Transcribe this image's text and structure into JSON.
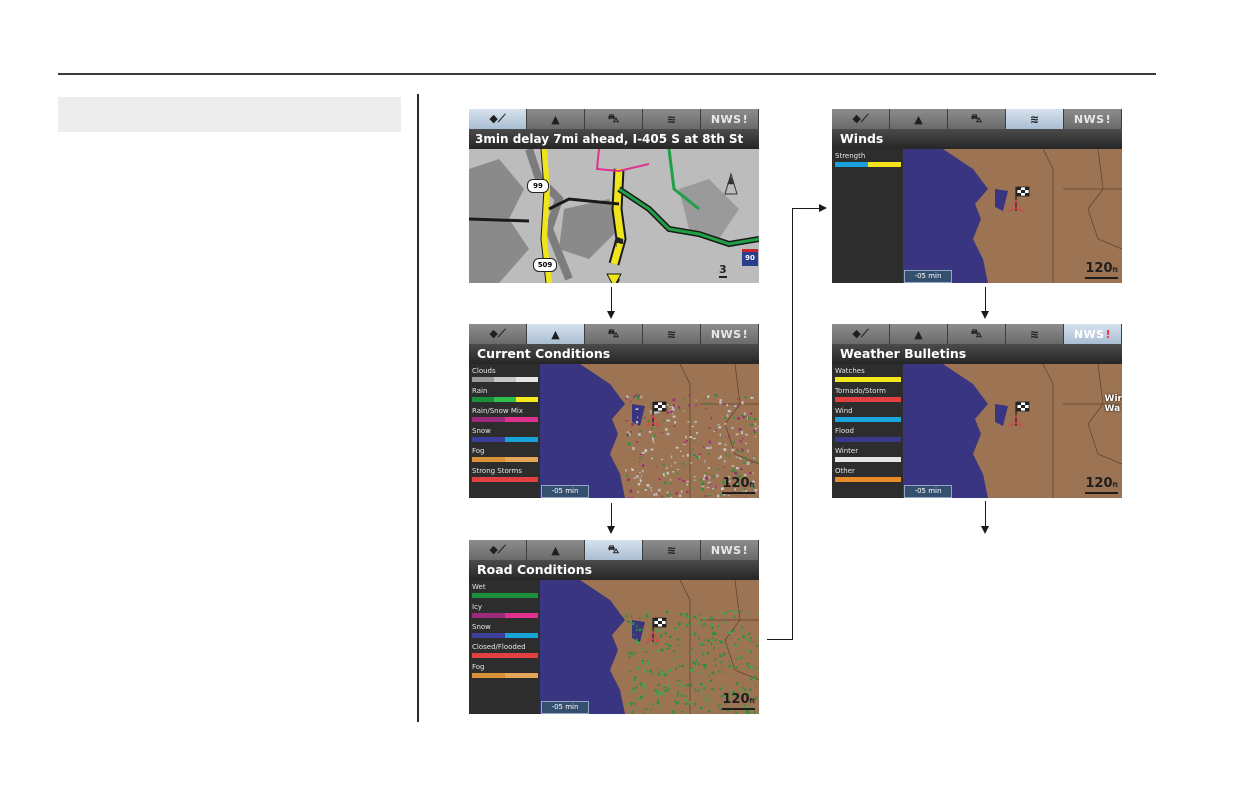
{
  "tabs": {
    "nws": "NWS",
    "nws_bang": "!"
  },
  "traffic": {
    "title": "3min delay 7mi ahead, I-405 S at 8th St",
    "shield_99": "99",
    "shield_509": "509",
    "shield_90": "90",
    "scale": "3"
  },
  "winds": {
    "title": "Winds",
    "legend": [
      {
        "label": "Strength",
        "colors": [
          "#1aa0dc",
          "#f4e31a"
        ]
      }
    ],
    "time": "-05 min",
    "scale": "120",
    "scale_unit": "ft"
  },
  "current": {
    "title": "Current Conditions",
    "legend": [
      {
        "label": "Clouds",
        "colors": [
          "#9a9a9a",
          "#c8c8c8",
          "#e5e5e5"
        ]
      },
      {
        "label": "Rain",
        "colors": [
          "#1c8f3c",
          "#2ec04a",
          "#f4ea1f"
        ]
      },
      {
        "label": "Rain/Snow Mix",
        "colors": [
          "#9b2a7a",
          "#e0318e"
        ]
      },
      {
        "label": "Snow",
        "colors": [
          "#3b3f9a",
          "#17a3d8"
        ]
      },
      {
        "label": "Fog",
        "colors": [
          "#d9913a",
          "#e3a659"
        ]
      },
      {
        "label": "Strong Storms",
        "colors": [
          "#e0403f"
        ]
      }
    ],
    "time": "-05 min",
    "scale": "120",
    "scale_unit": "ft"
  },
  "bulletins": {
    "title": "Weather Bulletins",
    "legend": [
      {
        "label": "Watches",
        "colors": [
          "#f4e71c"
        ]
      },
      {
        "label": "Tornado/Storm",
        "colors": [
          "#e0403f"
        ]
      },
      {
        "label": "Wind",
        "colors": [
          "#1aa6dc"
        ]
      },
      {
        "label": "Flood",
        "colors": [
          "#3a3a8a"
        ]
      },
      {
        "label": "Winter",
        "colors": [
          "#e6e6e6"
        ]
      },
      {
        "label": "Other",
        "colors": [
          "#e8892a"
        ]
      }
    ],
    "edge_text_1": "Wir",
    "edge_text_2": "Wa",
    "time": "-05 min",
    "scale": "120",
    "scale_unit": "ft"
  },
  "road": {
    "title": "Road Conditions",
    "legend": [
      {
        "label": "Wet",
        "colors": [
          "#1c8f3c"
        ]
      },
      {
        "label": "Icy",
        "colors": [
          "#9b2a7a",
          "#e0318e"
        ]
      },
      {
        "label": "Snow",
        "colors": [
          "#3b3f9a",
          "#17a3d8"
        ]
      },
      {
        "label": "Closed/Flooded",
        "colors": [
          "#e0403f"
        ]
      },
      {
        "label": "Fog",
        "colors": [
          "#d9913a",
          "#e3a659"
        ]
      }
    ],
    "time": "-05 min",
    "scale": "120",
    "scale_unit": "ft"
  },
  "colors": {
    "water": "#3a3580",
    "land": "#9c7453",
    "border": "#5a4030",
    "flag_marker": "#d24a4a"
  }
}
